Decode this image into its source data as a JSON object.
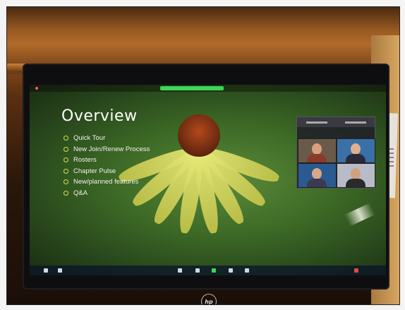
{
  "slide": {
    "title": "Overview",
    "bullets": [
      "Quick Tour",
      "New Join/Renew Process",
      "Rosters",
      "Chapter Pulse",
      "New/planned features",
      "Q&A"
    ]
  },
  "monitor": {
    "brand_logo": "hp"
  },
  "colors": {
    "bullet_accent": "#d6e24a",
    "zoom_green_bar": "#3fd45a",
    "flower_center": "#8a3414",
    "petal": "#e3e67a"
  },
  "icons": {
    "brand": "hp-logo-icon",
    "window_close": "red-dot-icon"
  }
}
